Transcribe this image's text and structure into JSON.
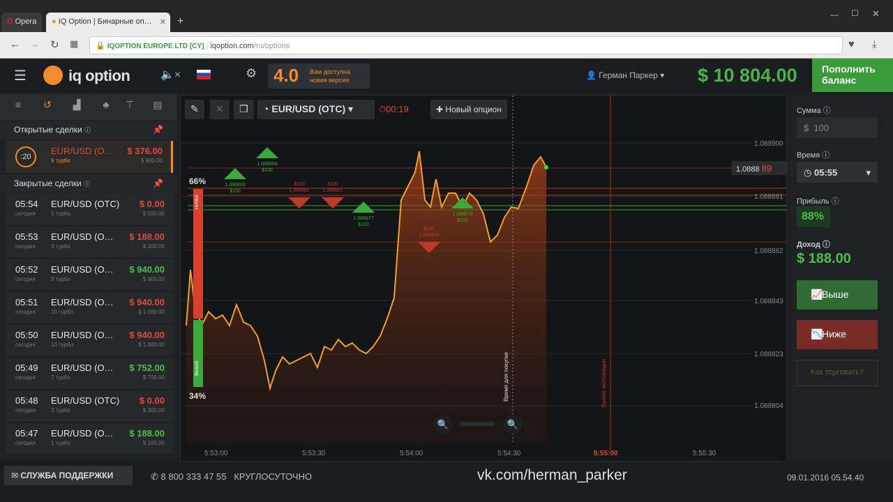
{
  "browser": {
    "opera_tab": "Opera",
    "tab_title": "IQ Option | Бинарные оп…",
    "site_label": "IQOPTION EUROPE LTD [CY]",
    "url": "iqoption.com",
    "url_path": "/ru/options"
  },
  "header": {
    "brand": "iq option",
    "version": "4.0",
    "version_note": "Вам доступна новая версия",
    "user": "Герман Паркер",
    "balance": "$ 10 804.00",
    "deposit": "Пополнить баланс"
  },
  "left": {
    "open_title": "Открытые сделки",
    "open_trade": {
      "timer": ":20",
      "asset": "EUR/USD (O…",
      "sub": "9 турбо",
      "profit": "$ 376.00",
      "invest": "$ 900.00"
    },
    "closed_title": "Закрытые сделки",
    "closed": [
      {
        "time": "05:54",
        "day": "сегодня",
        "asset": "EUR/USD (OTC)",
        "sub": "5 турбо",
        "profit": "$ 0.00",
        "invest": "$ 500.00",
        "color": "red"
      },
      {
        "time": "05:53",
        "day": "сегодня",
        "asset": "EUR/USD (O…",
        "sub": "3 турбо",
        "profit": "$ 188.00",
        "invest": "$ 300.00",
        "color": "red"
      },
      {
        "time": "05:52",
        "day": "сегодня",
        "asset": "EUR/USD (O…",
        "sub": "9 турбо",
        "profit": "$ 940.00",
        "invest": "$ 900.00",
        "color": "grn"
      },
      {
        "time": "05:51",
        "day": "сегодня",
        "asset": "EUR/USD (O…",
        "sub": "10 турбо",
        "profit": "$ 940.00",
        "invest": "$ 1 000.00",
        "color": "red"
      },
      {
        "time": "05:50",
        "day": "сегодня",
        "asset": "EUR/USD (O…",
        "sub": "10 турбо",
        "profit": "$ 940.00",
        "invest": "$ 1 000.00",
        "color": "red"
      },
      {
        "time": "05:49",
        "day": "сегодня",
        "asset": "EUR/USD (O…",
        "sub": "7 турбо",
        "profit": "$ 752.00",
        "invest": "$ 700.00",
        "color": "grn"
      },
      {
        "time": "05:48",
        "day": "сегодня",
        "asset": "EUR/USD (OTC)",
        "sub": "3 турбо",
        "profit": "$ 0.00",
        "invest": "$ 300.00",
        "color": "red"
      },
      {
        "time": "05:47",
        "day": "сегодня",
        "asset": "EUR/USD (O…",
        "sub": "1 турбо",
        "profit": "$ 188.00",
        "invest": "$ 100.00",
        "color": "grn"
      }
    ]
  },
  "chart": {
    "asset": "EUR/USD (OTC)",
    "timer": "00:19",
    "new_option": "Новый опцион",
    "pct_up": "66%",
    "pct_down": "34%",
    "label_down": "НИЖЕ",
    "label_up": "ВЫШЕ",
    "price_tag": "1.0888",
    "price_tag_hi": "89",
    "y_labels": [
      "1.088900",
      "1.088881",
      "1.088862",
      "1.088843",
      "1.088823",
      "1.088804"
    ],
    "x_labels": [
      "5:53:00",
      "5:53:30",
      "5:54:00",
      "5:54:30",
      "5:55:00",
      "5:55:30"
    ],
    "buy_line": "Время для покупки",
    "exp_line": "Время экспирации",
    "markers": [
      {
        "dir": "up",
        "price": "1.088899",
        "amt": "$100"
      },
      {
        "dir": "up",
        "price": "1.088888",
        "amt": "$100"
      },
      {
        "dir": "down",
        "price": "1.088881",
        "amt": "$100"
      },
      {
        "dir": "down",
        "price": "1.088881",
        "amt": "$100"
      },
      {
        "dir": "up",
        "price": "1.088877",
        "amt": "$100"
      },
      {
        "dir": "down",
        "price": "1.088866",
        "amt": "$100"
      },
      {
        "dir": "up",
        "price": "1.088878",
        "amt": "$100"
      }
    ]
  },
  "right": {
    "amount_label": "Сумма",
    "amount": "$  100",
    "time_label": "Время",
    "time": "05:55",
    "profit_label": "Прибыль",
    "profit": "88%",
    "income_label": "Доход",
    "income": "$ 188.00",
    "higher": "Выше",
    "lower": "Ниже",
    "howto": "Как торговать?"
  },
  "footer": {
    "support": "СЛУЖБА ПОДДЕРЖКИ",
    "phone": "8 800 333 47 55",
    "hours": "КРУГЛОСУТОЧНО",
    "watermark": "vk.com/herman_parker",
    "datetime": "09.01.2016 05.54.40"
  },
  "colors": {
    "accent": "#f08c2b",
    "green": "#4bbf4b",
    "red": "#e04a3a"
  }
}
